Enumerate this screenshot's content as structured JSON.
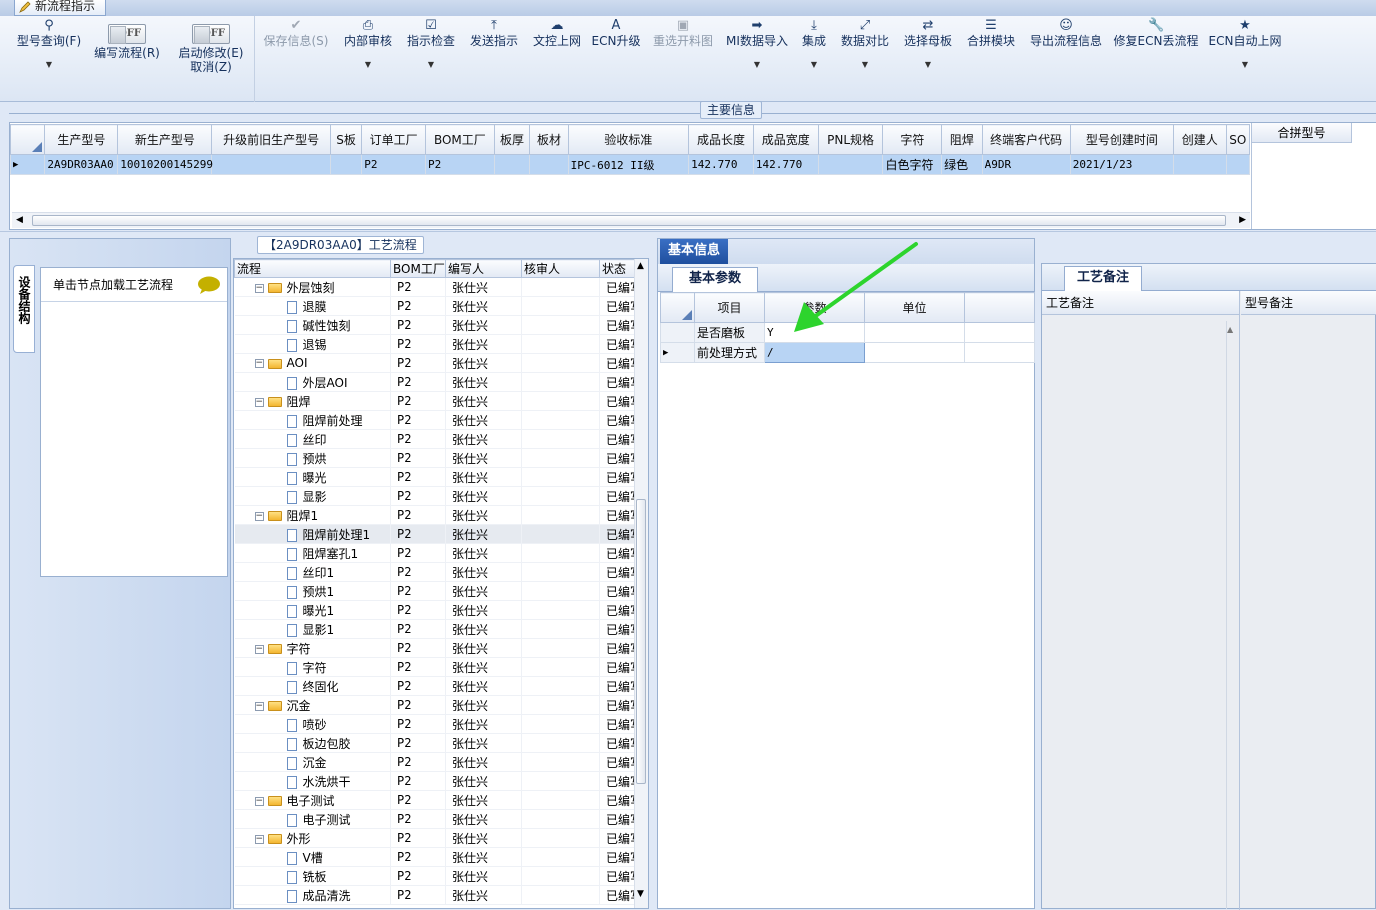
{
  "window": {
    "tab_title": "新流程指示"
  },
  "toolbar": {
    "model_query": "型号查询(F)",
    "off_label": "OFF",
    "write_flow": "编写流程(R)",
    "start_modify": "启动修改(E)",
    "cancel": "取消(Z)",
    "save_info": "保存信息(S)",
    "internal_review": "内部审核",
    "instr_check": "指示检查",
    "send_instr": "发送指示",
    "doc_upload": "文控上网",
    "ecn_upgrade": "ECN升级",
    "recut_chart": "重选开料图",
    "mi_import": "MI数据导入",
    "integrate": "集成",
    "data_compare": "数据对比",
    "select_master": "选择母板",
    "merge_module": "合拼模块",
    "export_flow": "导出流程信息",
    "fix_ecn": "修复ECN丢流程",
    "ecn_auto_upload": "ECN自动上网"
  },
  "main_info": {
    "caption": "主要信息",
    "columns": [
      "生产型号",
      "新生产型号",
      "升级前旧生产型号",
      "S板",
      "订单工厂",
      "BOM工厂",
      "板厚",
      "板材",
      "验收标准",
      "成品长度",
      "成品宽度",
      "PNL规格",
      "字符",
      "阻焊",
      "终端客户代码",
      "型号创建时间",
      "创建人",
      "SO"
    ],
    "row": [
      "2A9DR03AA0",
      "10010200145299",
      "",
      "",
      "P2",
      "P2",
      "",
      "",
      "IPC-6012 II级",
      "142.770",
      "142.770",
      "",
      "白色字符",
      "绿色",
      "A9DR",
      "2021/1/23",
      "",
      ""
    ],
    "merge_header": "合拼型号"
  },
  "left_panel": {
    "vtab": "设备结构",
    "hint": "单击节点加载工艺流程"
  },
  "flow_panel": {
    "caption": "【2A9DR03AA0】工艺流程",
    "columns": [
      "流程",
      "BOM工厂",
      "编写人",
      "核审人",
      "状态"
    ],
    "rows": [
      {
        "name": "外层蚀刻",
        "type": "folder",
        "bom": "P2",
        "writer": "张仕兴",
        "status": "已编写"
      },
      {
        "name": "退膜",
        "type": "doc",
        "bom": "P2",
        "writer": "张仕兴",
        "status": "已编写"
      },
      {
        "name": "碱性蚀刻",
        "type": "doc",
        "bom": "P2",
        "writer": "张仕兴",
        "status": "已编写"
      },
      {
        "name": "退锡",
        "type": "doc",
        "bom": "P2",
        "writer": "张仕兴",
        "status": "已编写"
      },
      {
        "name": "AOI",
        "type": "folder",
        "bom": "P2",
        "writer": "张仕兴",
        "status": "已编写"
      },
      {
        "name": "外层AOI",
        "type": "doc",
        "bom": "P2",
        "writer": "张仕兴",
        "status": "已编写"
      },
      {
        "name": "阻焊",
        "type": "folder",
        "bom": "P2",
        "writer": "张仕兴",
        "status": "已编写"
      },
      {
        "name": "阻焊前处理",
        "type": "doc",
        "bom": "P2",
        "writer": "张仕兴",
        "status": "已编写"
      },
      {
        "name": "丝印",
        "type": "doc",
        "bom": "P2",
        "writer": "张仕兴",
        "status": "已编写"
      },
      {
        "name": "预烘",
        "type": "doc",
        "bom": "P2",
        "writer": "张仕兴",
        "status": "已编写"
      },
      {
        "name": "曝光",
        "type": "doc",
        "bom": "P2",
        "writer": "张仕兴",
        "status": "已编写"
      },
      {
        "name": "显影",
        "type": "doc",
        "bom": "P2",
        "writer": "张仕兴",
        "status": "已编写"
      },
      {
        "name": "阻焊1",
        "type": "folder",
        "bom": "P2",
        "writer": "张仕兴",
        "status": "已编写"
      },
      {
        "name": "阻焊前处理1",
        "type": "doc",
        "bom": "P2",
        "writer": "张仕兴",
        "status": "已编写"
      },
      {
        "name": "阻焊塞孔1",
        "type": "doc",
        "bom": "P2",
        "writer": "张仕兴",
        "status": "已编写"
      },
      {
        "name": "丝印1",
        "type": "doc",
        "bom": "P2",
        "writer": "张仕兴",
        "status": "已编写"
      },
      {
        "name": "预烘1",
        "type": "doc",
        "bom": "P2",
        "writer": "张仕兴",
        "status": "已编写"
      },
      {
        "name": "曝光1",
        "type": "doc",
        "bom": "P2",
        "writer": "张仕兴",
        "status": "已编写"
      },
      {
        "name": "显影1",
        "type": "doc",
        "bom": "P2",
        "writer": "张仕兴",
        "status": "已编写"
      },
      {
        "name": "字符",
        "type": "folder",
        "bom": "P2",
        "writer": "张仕兴",
        "status": "已编写"
      },
      {
        "name": "字符",
        "type": "doc",
        "bom": "P2",
        "writer": "张仕兴",
        "status": "已编写"
      },
      {
        "name": "终固化",
        "type": "doc",
        "bom": "P2",
        "writer": "张仕兴",
        "status": "已编写"
      },
      {
        "name": "沉金",
        "type": "folder",
        "bom": "P2",
        "writer": "张仕兴",
        "status": "已编写"
      },
      {
        "name": "喷砂",
        "type": "doc",
        "bom": "P2",
        "writer": "张仕兴",
        "status": "已编写"
      },
      {
        "name": "板边包胶",
        "type": "doc",
        "bom": "P2",
        "writer": "张仕兴",
        "status": "已编写"
      },
      {
        "name": "沉金",
        "type": "doc",
        "bom": "P2",
        "writer": "张仕兴",
        "status": "已编写"
      },
      {
        "name": "水洗烘干",
        "type": "doc",
        "bom": "P2",
        "writer": "张仕兴",
        "status": "已编写"
      },
      {
        "name": "电子测试",
        "type": "folder",
        "bom": "P2",
        "writer": "张仕兴",
        "status": "已编写"
      },
      {
        "name": "电子测试",
        "type": "doc",
        "bom": "P2",
        "writer": "张仕兴",
        "status": "已编写"
      },
      {
        "name": "外形",
        "type": "folder",
        "bom": "P2",
        "writer": "张仕兴",
        "status": "已编写"
      },
      {
        "name": "V槽",
        "type": "doc",
        "bom": "P2",
        "writer": "张仕兴",
        "status": "已编写"
      },
      {
        "name": "铣板",
        "type": "doc",
        "bom": "P2",
        "writer": "张仕兴",
        "status": "已编写"
      },
      {
        "name": "成品清洗",
        "type": "doc",
        "bom": "P2",
        "writer": "张仕兴",
        "status": "已编写"
      }
    ]
  },
  "basic_info": {
    "tab": "基本信息",
    "subtab": "基本参数",
    "columns": [
      "项目",
      "参数",
      "单位"
    ],
    "rows": [
      {
        "item": "是否磨板",
        "param": "Y",
        "unit": ""
      },
      {
        "item": "前处理方式",
        "param": "/",
        "unit": ""
      }
    ]
  },
  "notes": {
    "tab": "工艺备注",
    "col1": "工艺备注",
    "col2": "型号备注"
  }
}
